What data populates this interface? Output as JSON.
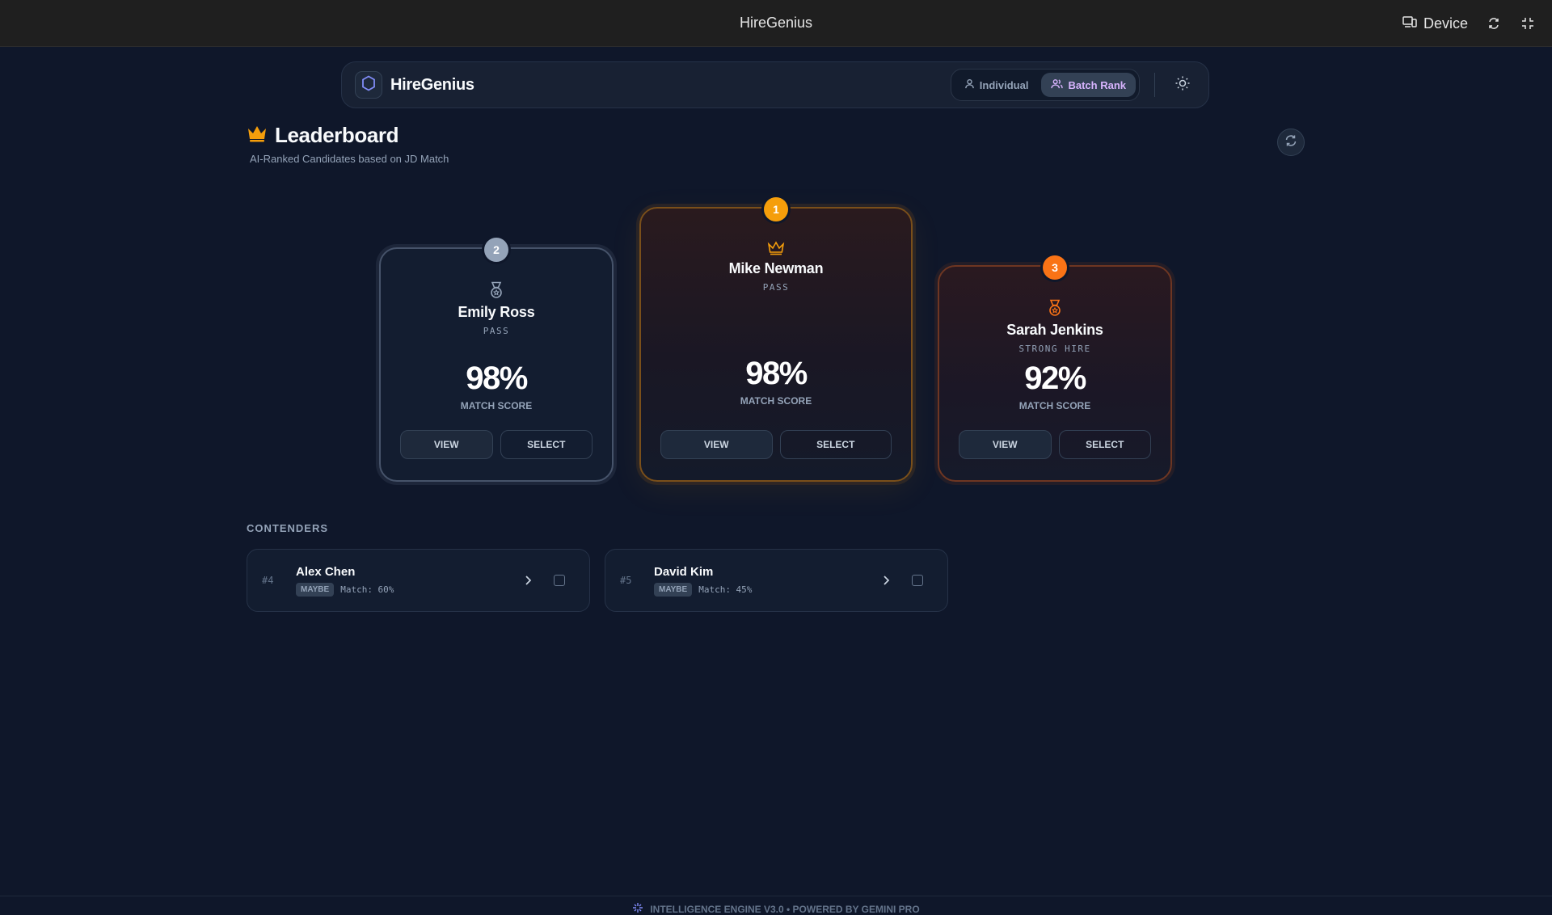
{
  "window": {
    "title": "HireGenius",
    "device_label": "Device"
  },
  "nav": {
    "brand": "HireGenius",
    "modes": [
      {
        "label": "Individual",
        "icon": "user-icon",
        "active": false
      },
      {
        "label": "Batch Rank",
        "icon": "users-icon",
        "active": true
      }
    ],
    "theme_icon": "sun-icon"
  },
  "leaderboard": {
    "title": "Leaderboard",
    "subtitle": "AI-Ranked Candidates based on JD Match",
    "title_icon": "crown-icon",
    "refresh_icon": "refresh-icon"
  },
  "podium": {
    "first": {
      "rank": "1",
      "name": "Mike Newman",
      "status": "PASS",
      "score": "98%",
      "score_label": "MATCH SCORE",
      "icon": "crown-icon",
      "view_label": "VIEW",
      "select_label": "SELECT"
    },
    "second": {
      "rank": "2",
      "name": "Emily Ross",
      "status": "PASS",
      "score": "98%",
      "score_label": "MATCH SCORE",
      "icon": "medal-icon",
      "view_label": "VIEW",
      "select_label": "SELECT"
    },
    "third": {
      "rank": "3",
      "name": "Sarah Jenkins",
      "status": "STRONG HIRE",
      "score": "92%",
      "score_label": "MATCH SCORE",
      "icon": "medal-icon",
      "view_label": "VIEW",
      "select_label": "SELECT"
    }
  },
  "contenders": {
    "title": "CONTENDERS",
    "items": [
      {
        "rank": "#4",
        "name": "Alex Chen",
        "tag": "MAYBE",
        "match": "Match: 60%"
      },
      {
        "rank": "#5",
        "name": "David Kim",
        "tag": "MAYBE",
        "match": "Match: 45%"
      }
    ]
  },
  "footer": {
    "text": "INTELLIGENCE ENGINE V3.0 • POWERED BY GEMINI PRO",
    "icon": "sparkle-icon"
  },
  "colors": {
    "background": "#0f172a",
    "gold": "#f59e0b",
    "silver": "#94a3b8",
    "bronze": "#f97316",
    "accent": "#d8b4fe",
    "logo": "#818cf8"
  }
}
